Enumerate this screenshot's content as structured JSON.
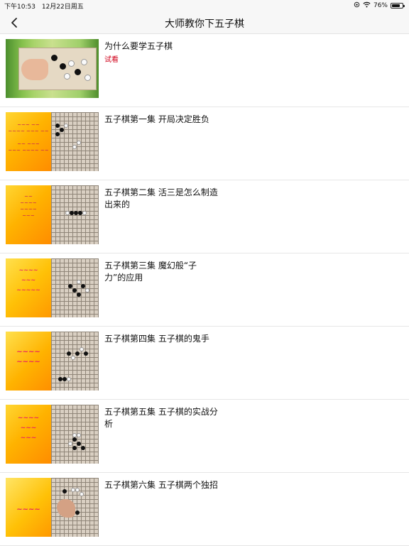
{
  "status": {
    "time": "下午10:53",
    "date": "12月22日周五",
    "battery": "76%",
    "battery_level": 0.76
  },
  "nav": {
    "title": "大师教你下五子棋"
  },
  "icons": {
    "back": "chevron-left-icon",
    "wifi": "wifi-icon",
    "battery": "battery-icon",
    "lock": "rotation-lock-icon"
  },
  "colors": {
    "accent": "#d0021b",
    "thumb_bg": "#ffb300"
  },
  "items": [
    {
      "title": "为什么要学五子棋",
      "tag": "试看"
    },
    {
      "title": "五子棋第一集 开局决定胜负"
    },
    {
      "title": "五子棋第二集 活三是怎么制造出来的"
    },
    {
      "title": "五子棋第三集 魔幻般“子力”的应用"
    },
    {
      "title": "五子棋第四集 五子棋的鬼手"
    },
    {
      "title": "五子棋第五集 五子棋的实战分析"
    },
    {
      "title": "五子棋第六集 五子棋两个独招"
    }
  ]
}
